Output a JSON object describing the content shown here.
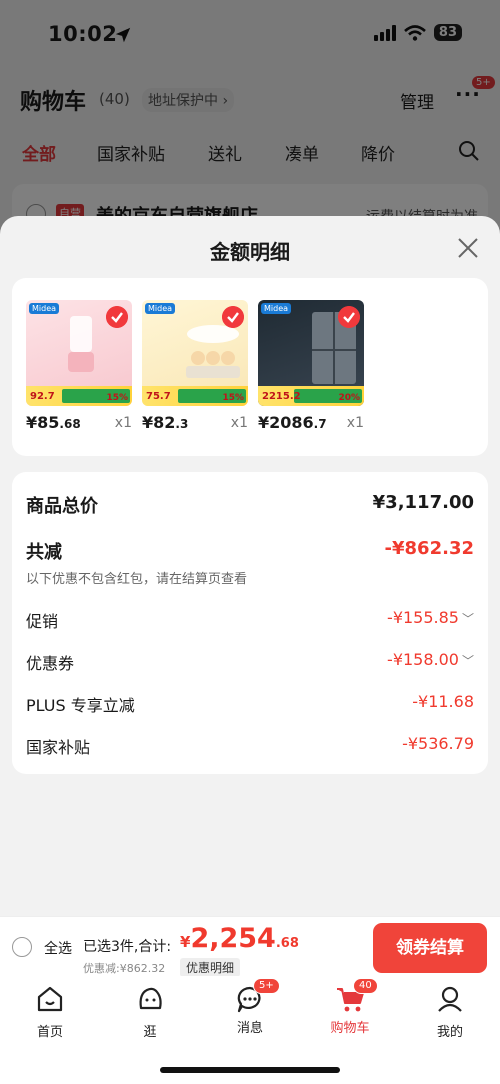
{
  "status_bar": {
    "time": "10:02",
    "battery": "83"
  },
  "header": {
    "title": "购物车",
    "count": "(40)",
    "address_protect": "地址保护中",
    "manage": "管理",
    "more_badge": "5+"
  },
  "filters": [
    "全部",
    "国家补贴",
    "送礼",
    "凑单",
    "降价"
  ],
  "shop": {
    "tag": "自营",
    "name": "美的京东自营旗舰店",
    "shipping": "运费以结算时为准"
  },
  "sheet": {
    "title": "金额明细",
    "products": [
      {
        "image": "blender-product-image",
        "price_int": "¥85",
        "price_dec": ".68",
        "qty": "x1",
        "img_price": "92.7",
        "img_pct": "15%"
      },
      {
        "image": "egg-steamer-product-image",
        "price_int": "¥82",
        "price_dec": ".3",
        "qty": "x1",
        "img_price": "75.7",
        "img_pct": "15%"
      },
      {
        "image": "refrigerator-product-image",
        "price_int": "¥2086",
        "price_dec": ".7",
        "qty": "x1",
        "img_price": "2215.2",
        "img_pct": "20%"
      }
    ],
    "details": {
      "subtotal_label": "商品总价",
      "subtotal_value": "¥3,117.00",
      "discount_label": "共减",
      "discount_value": "-¥862.32",
      "discount_note": "以下优惠不包含红包，请在结算页查看",
      "promo_label": "促销",
      "promo_value": "-¥155.85",
      "coupon_label": "优惠券",
      "coupon_value": "-¥158.00",
      "plus_label": "PLUS 专享立减",
      "plus_value": "-¥11.68",
      "subsidy_label": "国家补贴",
      "subsidy_value": "-¥536.79"
    }
  },
  "checkout": {
    "select_all": "全选",
    "selected": "已选3件,合计:",
    "currency": "¥",
    "total_int": "2,254",
    "total_dec": ".68",
    "saved": "优惠减:¥862.32",
    "detail_chip": "优惠明细",
    "button": "领券结算"
  },
  "tabbar": {
    "items": [
      {
        "label": "首页",
        "icon": "home-icon"
      },
      {
        "label": "逛",
        "icon": "explore-icon"
      },
      {
        "label": "消息",
        "icon": "message-icon",
        "badge": "5+"
      },
      {
        "label": "购物车",
        "icon": "cart-icon",
        "badge": "40"
      },
      {
        "label": "我的",
        "icon": "profile-icon"
      }
    ]
  },
  "colors": {
    "accent": "#f03a2e",
    "brand_red": "#e4393c"
  }
}
